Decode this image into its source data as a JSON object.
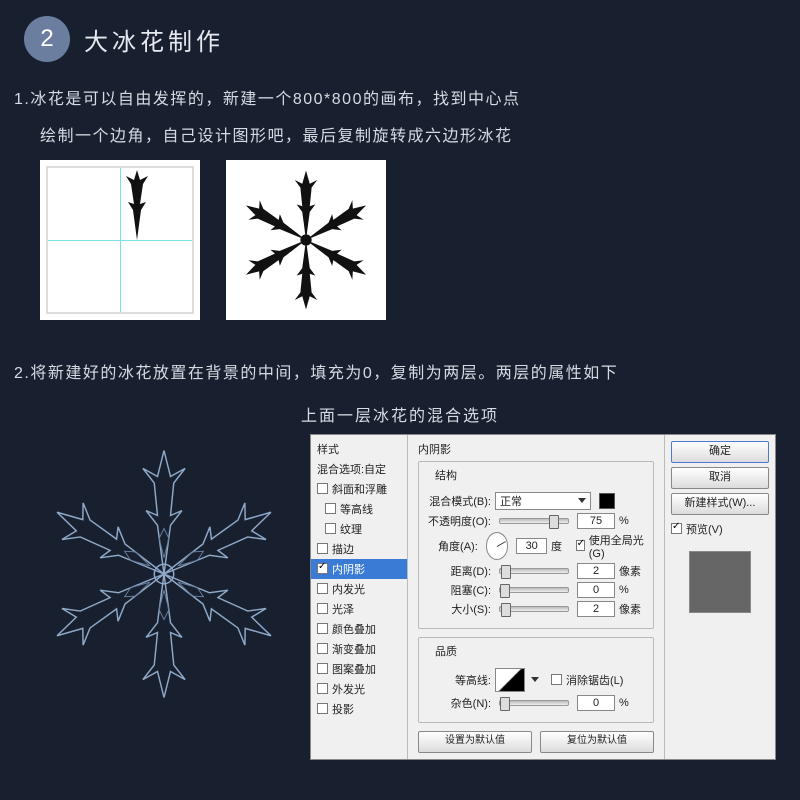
{
  "step_number": "2",
  "title": "大冰花制作",
  "p1_line1": "1.冰花是可以自由发挥的，新建一个800*800的画布，找到中心点",
  "p1_line2": "绘制一个边角，自己设计图形吧，最后复制旋转成六边形冰花",
  "p2": "2.将新建好的冰花放置在背景的中间，填充为0，复制为两层。两层的属性如下",
  "caption": "上面一层冰花的混合选项",
  "dialog": {
    "left": {
      "header": "样式",
      "blend_sub": "混合选项:自定",
      "items": [
        {
          "label": "斜面和浮雕",
          "checked": false
        },
        {
          "label": "等高线",
          "checked": false,
          "indent": true
        },
        {
          "label": "纹理",
          "checked": false,
          "indent": true
        },
        {
          "label": "描边",
          "checked": false
        },
        {
          "label": "内阴影",
          "checked": true,
          "selected": true
        },
        {
          "label": "内发光",
          "checked": false
        },
        {
          "label": "光泽",
          "checked": false
        },
        {
          "label": "颜色叠加",
          "checked": false
        },
        {
          "label": "渐变叠加",
          "checked": false
        },
        {
          "label": "图案叠加",
          "checked": false
        },
        {
          "label": "外发光",
          "checked": false
        },
        {
          "label": "投影",
          "checked": false
        }
      ]
    },
    "mid": {
      "panel_title": "内阴影",
      "structure_title": "结构",
      "blend_mode_label": "混合模式(B):",
      "blend_mode_value": "正常",
      "opacity_label": "不透明度(O):",
      "opacity_value": "75",
      "opacity_unit": "%",
      "angle_label": "角度(A):",
      "angle_value": "30",
      "angle_unit": "度",
      "global_light": "使用全局光(G)",
      "distance_label": "距离(D):",
      "distance_value": "2",
      "distance_unit": "像素",
      "choke_label": "阻塞(C):",
      "choke_value": "0",
      "choke_unit": "%",
      "size_label": "大小(S):",
      "size_value": "2",
      "size_unit": "像素",
      "quality_title": "品质",
      "contour_label": "等高线:",
      "antialias": "消除锯齿(L)",
      "noise_label": "杂色(N):",
      "noise_value": "0",
      "noise_unit": "%",
      "make_default": "设置为默认值",
      "reset_default": "复位为默认值"
    },
    "right": {
      "ok": "确定",
      "cancel": "取消",
      "new_style": "新建样式(W)...",
      "preview": "预览(V)"
    }
  }
}
